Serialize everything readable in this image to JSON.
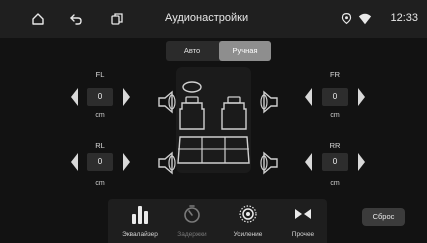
{
  "status_bar": {
    "title": "Аудионастройки",
    "time": "12:33",
    "icons": [
      "home-icon",
      "back-icon",
      "recent-apps-icon",
      "location-icon",
      "wifi-icon"
    ]
  },
  "mode": {
    "options": [
      "Авто",
      "Ручная"
    ],
    "selected": "Ручная"
  },
  "channels": {
    "fl": {
      "label": "FL",
      "value": "0",
      "unit": "cm"
    },
    "fr": {
      "label": "FR",
      "value": "0",
      "unit": "cm"
    },
    "rl": {
      "label": "RL",
      "value": "0",
      "unit": "cm"
    },
    "rr": {
      "label": "RR",
      "value": "0",
      "unit": "cm"
    }
  },
  "tabs": [
    {
      "label": "Эквалайзер",
      "icon": "equalizer-icon",
      "active": true
    },
    {
      "label": "Задержки",
      "icon": "delay-timer-icon",
      "active": false
    },
    {
      "label": "Усиление",
      "icon": "gain-icon",
      "active": true
    },
    {
      "label": "Прочее",
      "icon": "balance-icon",
      "active": true
    }
  ],
  "reset_label": "Сброс",
  "colors": {
    "background": "#121212",
    "status_bar": "#1f1f1f",
    "active_mode": "#8e8e8e",
    "value_box": "#2d2d2d"
  }
}
